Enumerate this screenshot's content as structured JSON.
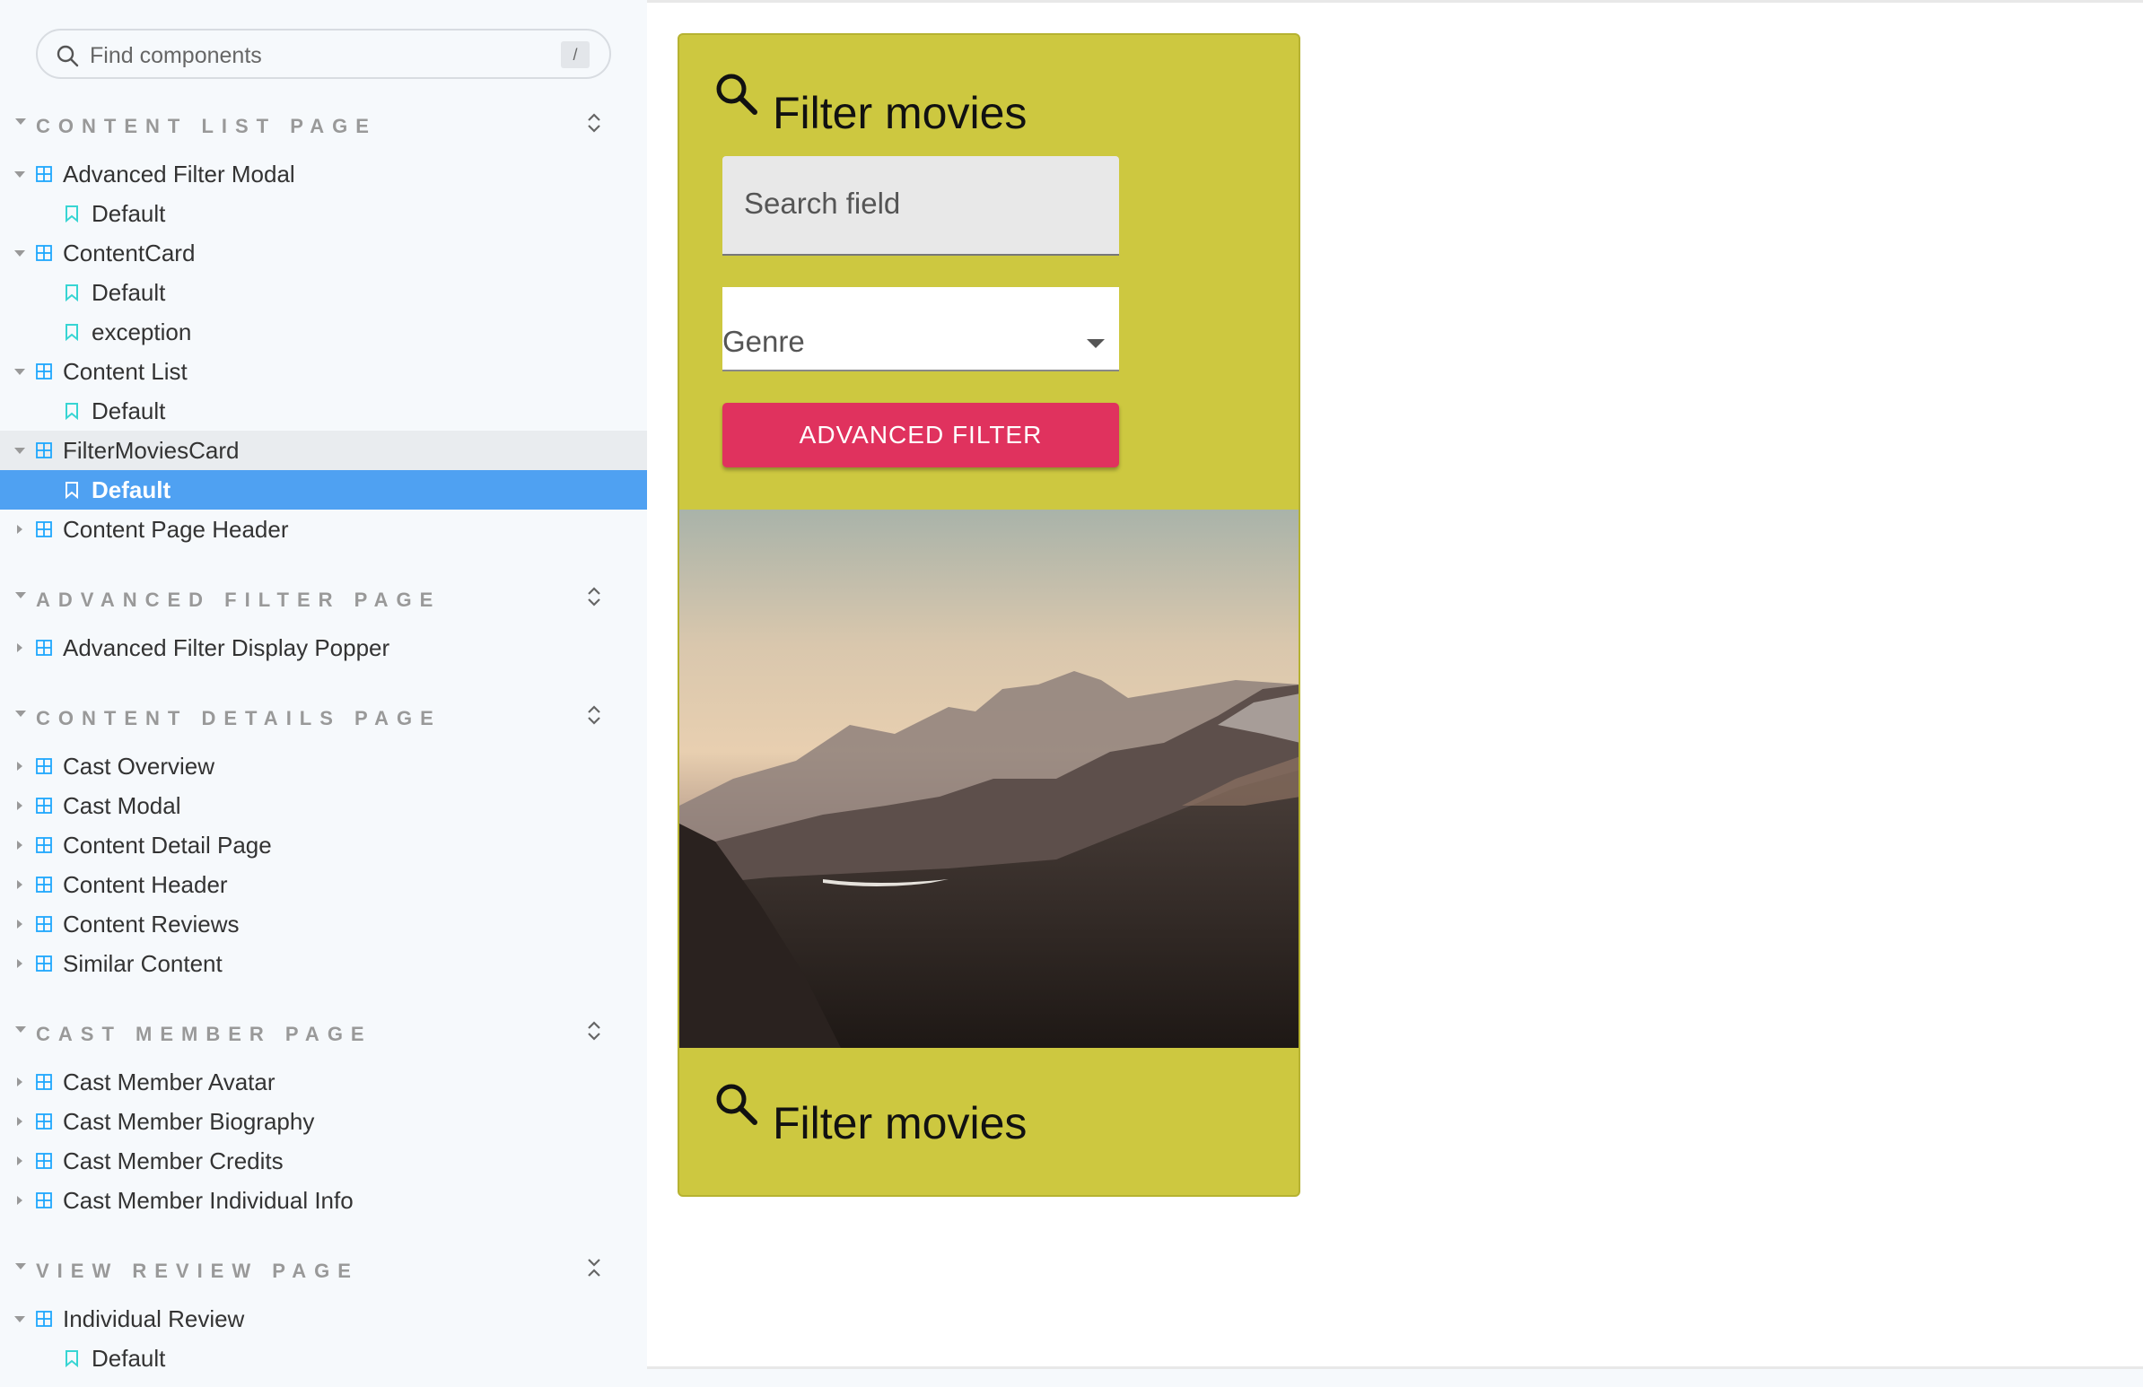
{
  "search": {
    "placeholder": "Find components",
    "shortcut": "/"
  },
  "sections": [
    {
      "title": "CONTENT LIST PAGE",
      "items": [
        {
          "type": "component",
          "label": "Advanced Filter Modal",
          "expanded": true
        },
        {
          "type": "story",
          "label": "Default"
        },
        {
          "type": "component",
          "label": "ContentCard",
          "expanded": true
        },
        {
          "type": "story",
          "label": "Default"
        },
        {
          "type": "story",
          "label": "exception"
        },
        {
          "type": "component",
          "label": "Content List",
          "expanded": true
        },
        {
          "type": "story",
          "label": "Default"
        },
        {
          "type": "component",
          "label": "FilterMoviesCard",
          "expanded": true,
          "highlighted": true
        },
        {
          "type": "story",
          "label": "Default",
          "selected": true
        },
        {
          "type": "component",
          "label": "Content Page Header",
          "expanded": false
        }
      ]
    },
    {
      "title": "ADVANCED FILTER PAGE",
      "items": [
        {
          "type": "component",
          "label": "Advanced Filter Display Popper",
          "expanded": false
        }
      ]
    },
    {
      "title": "CONTENT DETAILS PAGE",
      "items": [
        {
          "type": "component",
          "label": "Cast Overview",
          "expanded": false
        },
        {
          "type": "component",
          "label": "Cast Modal",
          "expanded": false
        },
        {
          "type": "component",
          "label": "Content Detail Page",
          "expanded": false
        },
        {
          "type": "component",
          "label": "Content Header",
          "expanded": false
        },
        {
          "type": "component",
          "label": "Content Reviews",
          "expanded": false
        },
        {
          "type": "component",
          "label": "Similar Content",
          "expanded": false
        }
      ]
    },
    {
      "title": "CAST MEMBER PAGE",
      "items": [
        {
          "type": "component",
          "label": "Cast Member Avatar",
          "expanded": false
        },
        {
          "type": "component",
          "label": "Cast Member Biography",
          "expanded": false
        },
        {
          "type": "component",
          "label": "Cast Member Credits",
          "expanded": false
        },
        {
          "type": "component",
          "label": "Cast Member Individual Info",
          "expanded": false
        }
      ]
    },
    {
      "title": "VIEW REVIEW PAGE",
      "items": [
        {
          "type": "component",
          "label": "Individual Review",
          "expanded": true
        },
        {
          "type": "story",
          "label": "Default"
        }
      ]
    }
  ],
  "card": {
    "title": "Filter movies",
    "search_placeholder": "Search field",
    "genre_label": "Genre",
    "button_label": "ADVANCED FILTER",
    "footer_title": "Filter movies",
    "colors": {
      "card_bg": "#cdc840",
      "button_bg": "#e0325e",
      "selected_row": "#4fa1f2"
    }
  }
}
